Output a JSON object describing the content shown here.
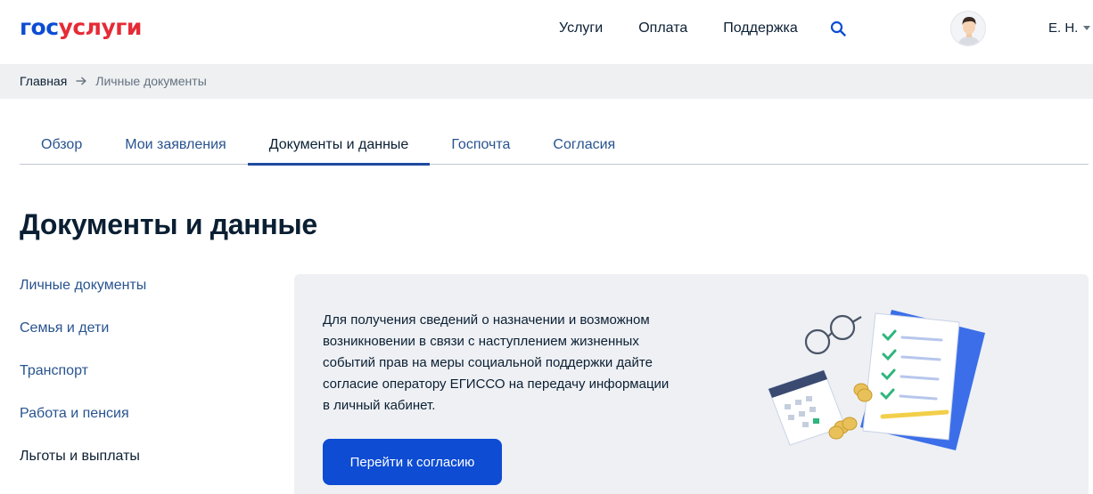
{
  "header": {
    "logo_part1": "гос",
    "logo_part2": "услуги",
    "nav": [
      "Услуги",
      "Оплата",
      "Поддержка"
    ],
    "user_name": "Е. Н."
  },
  "breadcrumb": {
    "home": "Главная",
    "current": "Личные документы"
  },
  "tabs": [
    {
      "label": "Обзор",
      "active": false
    },
    {
      "label": "Мои заявления",
      "active": false
    },
    {
      "label": "Документы и данные",
      "active": true
    },
    {
      "label": "Госпочта",
      "active": false
    },
    {
      "label": "Согласия",
      "active": false
    }
  ],
  "page_title": "Документы и данные",
  "side_menu": [
    {
      "label": "Личные документы",
      "active": false
    },
    {
      "label": "Семья и дети",
      "active": false
    },
    {
      "label": "Транспорт",
      "active": false
    },
    {
      "label": "Работа и пенсия",
      "active": false
    },
    {
      "label": "Льготы и выплаты",
      "active": true
    }
  ],
  "card": {
    "text": "Для получения сведений о назначении и возможном возникновении в связи с наступлением жизненных событий прав на меры социальной поддержки дайте согласие оператору ЕГИССО на передачу информации в личный кабинет.",
    "button_label": "Перейти к согласию"
  },
  "colors": {
    "brand_blue": "#0d4cd3",
    "brand_red": "#e52b36",
    "text": "#0b1f33",
    "link": "#28538f",
    "breadcrumb_bg": "#eef0f2",
    "card_bg": "#eef0f4"
  },
  "icons": [
    "search-icon",
    "arrow-right-icon",
    "avatar",
    "chevron-down-icon"
  ]
}
